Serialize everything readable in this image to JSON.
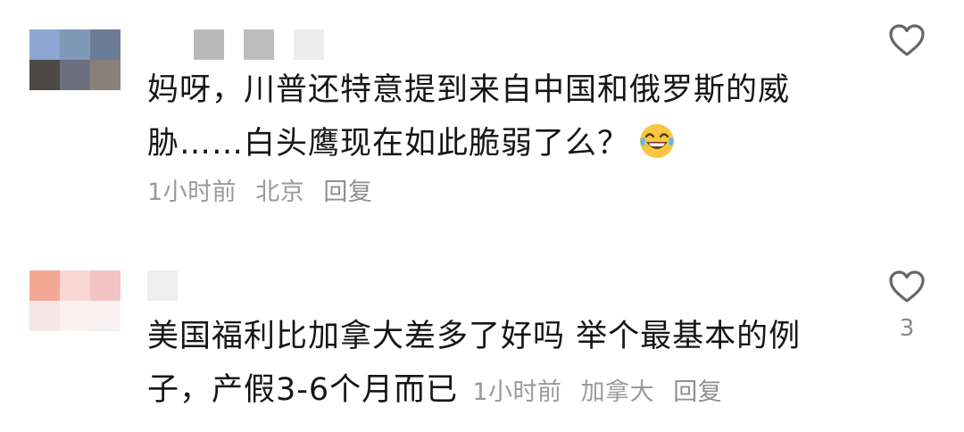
{
  "comments": [
    {
      "text_line1": "妈呀，川普还特意提到来自中国和俄罗斯的威",
      "text_line2": "胁……白头鹰现在如此脆弱了么？",
      "emoji": "laughing-tears-emoji",
      "time": "1小时前",
      "location": "北京",
      "reply_label": "回复",
      "like_count": "",
      "avatar_colors": [
        "#8da6d3",
        "#7f98b8",
        "#6c7c96",
        "#4d4946",
        "#6d6f7d",
        "#8a8079"
      ],
      "username_colors": [
        "#b9b9b9",
        "#bdbdbd",
        "#ededed"
      ]
    },
    {
      "text_line1": "美国福利比加拿大差多了好吗 举个最基本的例",
      "text_line2": "子，产假3-6个月而已",
      "time": "1小时前",
      "location": "加拿大",
      "reply_label": "回复",
      "like_count": "3",
      "avatar_colors": [
        "#f5a796",
        "#f9d7d2",
        "#f3c4c4",
        "#f6e8e6",
        "#fbf1f0",
        "#f9f2f2"
      ],
      "username_colors": [
        "#eeeeee"
      ]
    }
  ],
  "colors": {
    "text": "#161616",
    "meta": "#9a9a9a",
    "heart_outline": "#666666"
  }
}
